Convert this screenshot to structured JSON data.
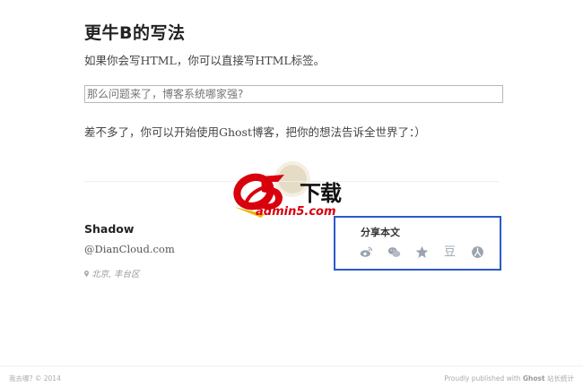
{
  "article": {
    "heading": "更牛B的写法",
    "paragraph1": "如果你会写HTML，你可以直接写HTML标签。",
    "input_placeholder": "那么问题来了，博客系统哪家强?",
    "paragraph2": "差不多了，你可以开始使用Ghost博客，把你的想法告诉全世界了：）"
  },
  "author": {
    "name": "Shadow",
    "website": "@DianCloud.com",
    "location": "北京, 丰台区"
  },
  "share": {
    "title": "分享本文",
    "icons": [
      "weibo-icon",
      "wechat-icon",
      "star-icon",
      "douban-icon",
      "renren-icon"
    ],
    "douban_glyph": "豆",
    "icon_color": "#9aa3ae",
    "border_color": "#2a5ac8"
  },
  "watermark": {
    "brand_number": "5",
    "brand_text": "下载",
    "url": "admin5.com"
  },
  "footer": {
    "site_name": "我去哪?",
    "copyright": "© 2014",
    "published_prefix": "Proudly published with",
    "ghost_label": "Ghost",
    "stats_label": "站长统计"
  }
}
